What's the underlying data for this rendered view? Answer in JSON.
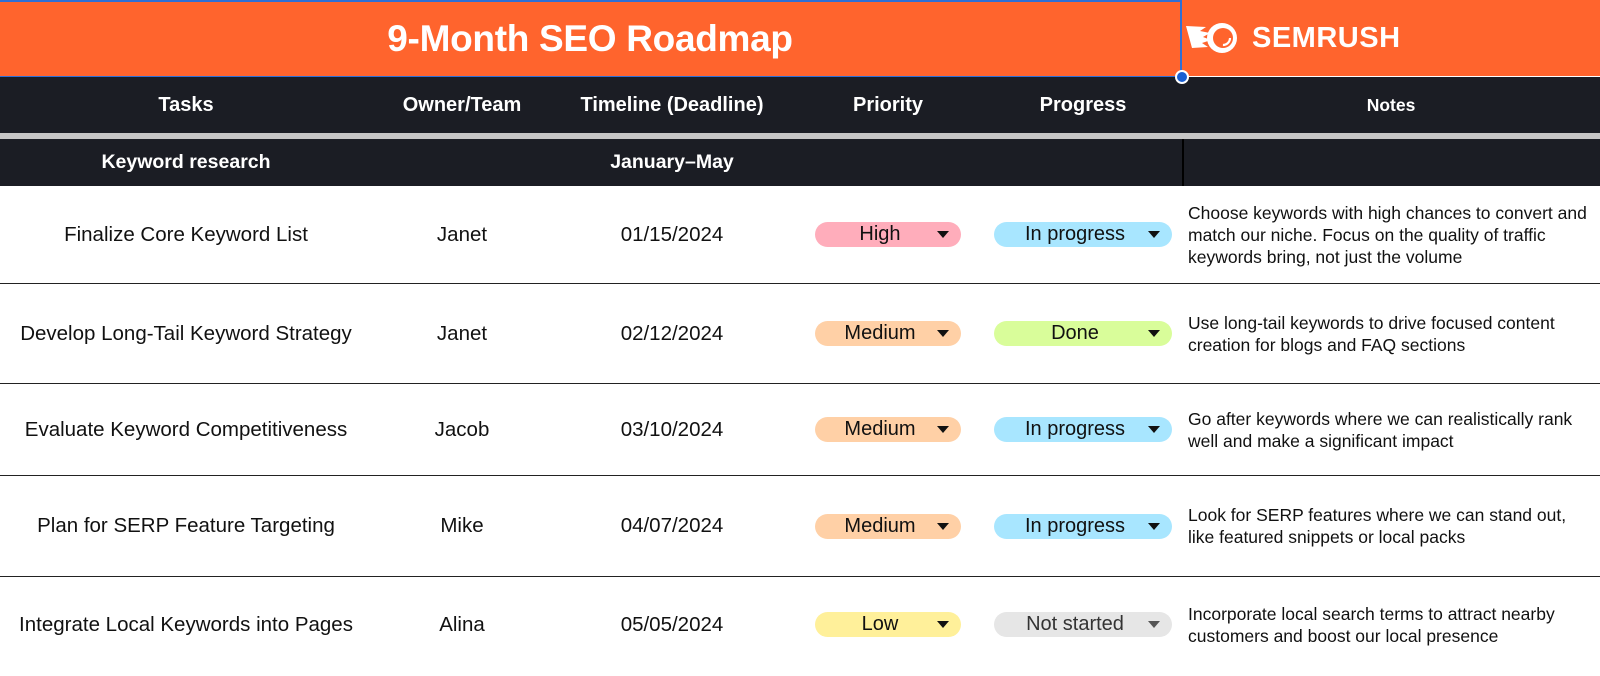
{
  "header": {
    "title": "9-Month SEO Roadmap",
    "brand": "SEMRUSH",
    "brand_color": "#ff642d"
  },
  "columns": [
    "Tasks",
    "Owner/Team",
    "Timeline (Deadline)",
    "Priority",
    "Progress",
    "Notes"
  ],
  "category": {
    "name": "Keyword research",
    "timeline": "January–May"
  },
  "rows": [
    {
      "task": "Finalize Core Keyword List",
      "owner": "Janet",
      "deadline": "01/15/2024",
      "priority": "High",
      "priority_color": "#ffadbb",
      "progress": "In progress",
      "progress_color": "#a8e6ff",
      "notes": "Choose keywords with high chances to convert and match our niche. Focus on the quality of traffic keywords bring, not just the volume"
    },
    {
      "task": "Develop Long-Tail Keyword Strategy",
      "owner": "Janet",
      "deadline": "02/12/2024",
      "priority": "Medium",
      "priority_color": "#ffd0a6",
      "progress": "Done",
      "progress_color": "#d9fd9a",
      "notes": "Use long-tail keywords to drive focused content creation for blogs and FAQ sections"
    },
    {
      "task": "Evaluate Keyword Competitiveness",
      "owner": "Jacob",
      "deadline": "03/10/2024",
      "priority": "Medium",
      "priority_color": "#ffd0a6",
      "progress": "In progress",
      "progress_color": "#a8e6ff",
      "notes": "Go after keywords where we can realistically rank well and make a significant impact"
    },
    {
      "task": "Plan for SERP Feature Targeting",
      "owner": "Mike",
      "deadline": "04/07/2024",
      "priority": "Medium",
      "priority_color": "#ffd0a6",
      "progress": "In progress",
      "progress_color": "#a8e6ff",
      "notes": "Look for SERP features where we can stand out, like featured snippets or local packs"
    },
    {
      "task": "Integrate Local Keywords into Pages",
      "owner": "Alina",
      "deadline": "05/05/2024",
      "priority": "Low",
      "priority_color": "#fff09a",
      "progress": "Not started",
      "progress_color": "#e6e6e6",
      "notes": "Incorporate local search terms to attract nearby customers and boost our local presence"
    }
  ]
}
